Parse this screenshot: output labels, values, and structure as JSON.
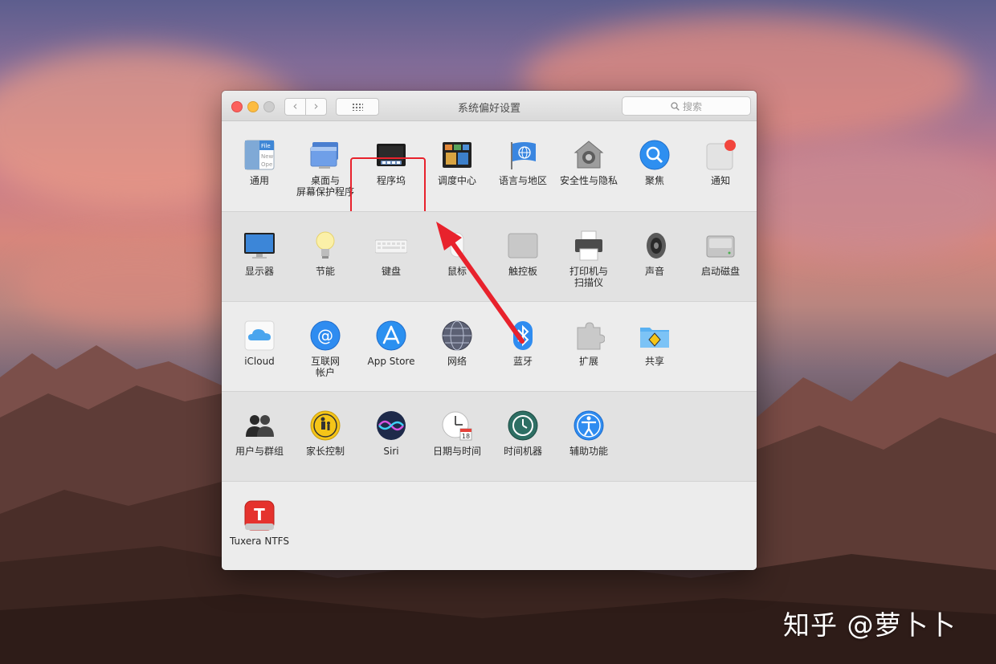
{
  "window": {
    "title": "系统偏好设置",
    "search_placeholder": "搜索",
    "nav_back": "‹",
    "nav_forward": "›"
  },
  "rows": [
    [
      {
        "label": "通用",
        "icon": "general-icon"
      },
      {
        "label": "桌面与\n屏幕保护程序",
        "icon": "desktop-screensaver-icon"
      },
      {
        "label": "程序坞",
        "icon": "dock-icon"
      },
      {
        "label": "调度中心",
        "icon": "mission-control-icon"
      },
      {
        "label": "语言与地区",
        "icon": "language-region-icon"
      },
      {
        "label": "安全性与隐私",
        "icon": "security-privacy-icon"
      },
      {
        "label": "聚焦",
        "icon": "spotlight-icon"
      },
      {
        "label": "通知",
        "icon": "notifications-icon"
      }
    ],
    [
      {
        "label": "显示器",
        "icon": "displays-icon"
      },
      {
        "label": "节能",
        "icon": "energy-saver-icon"
      },
      {
        "label": "键盘",
        "icon": "keyboard-icon"
      },
      {
        "label": "鼠标",
        "icon": "mouse-icon"
      },
      {
        "label": "触控板",
        "icon": "trackpad-icon"
      },
      {
        "label": "打印机与\n扫描仪",
        "icon": "printers-scanners-icon"
      },
      {
        "label": "声音",
        "icon": "sound-icon"
      },
      {
        "label": "启动磁盘",
        "icon": "startup-disk-icon"
      }
    ],
    [
      {
        "label": "iCloud",
        "icon": "icloud-icon"
      },
      {
        "label": "互联网\n帐户",
        "icon": "internet-accounts-icon"
      },
      {
        "label": "App Store",
        "icon": "app-store-icon"
      },
      {
        "label": "网络",
        "icon": "network-icon"
      },
      {
        "label": "蓝牙",
        "icon": "bluetooth-icon"
      },
      {
        "label": "扩展",
        "icon": "extensions-icon"
      },
      {
        "label": "共享",
        "icon": "sharing-icon"
      }
    ],
    [
      {
        "label": "用户与群组",
        "icon": "users-groups-icon"
      },
      {
        "label": "家长控制",
        "icon": "parental-controls-icon"
      },
      {
        "label": "Siri",
        "icon": "siri-icon"
      },
      {
        "label": "日期与时间",
        "icon": "date-time-icon"
      },
      {
        "label": "时间机器",
        "icon": "time-machine-icon"
      },
      {
        "label": "辅助功能",
        "icon": "accessibility-icon"
      }
    ],
    [
      {
        "label": "Tuxera NTFS",
        "icon": "tuxera-ntfs-icon"
      }
    ]
  ],
  "icon_text": {
    "general_file": "File",
    "general_new": "New",
    "general_open": "Ope",
    "date_day": "18",
    "tuxera_letter": "T"
  },
  "annotation": {
    "highlighted_item": "程序坞",
    "color": "#e8222c"
  },
  "watermark": "知乎 @萝卜卜"
}
